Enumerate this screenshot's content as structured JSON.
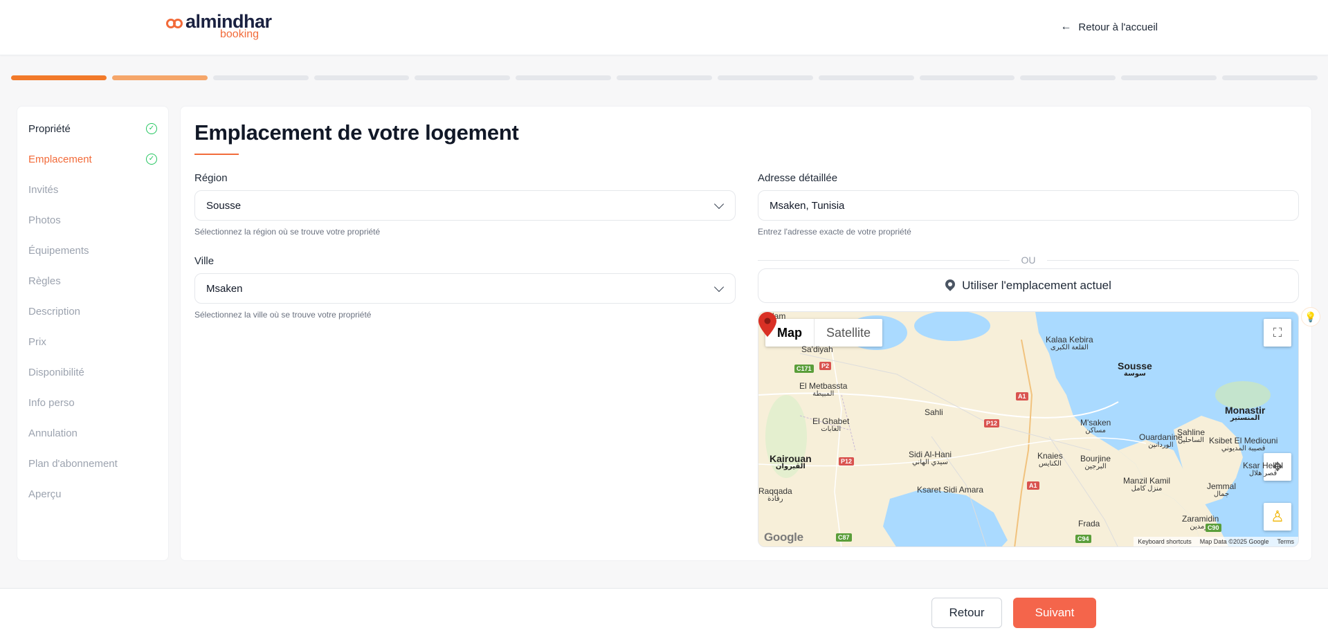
{
  "header": {
    "logo_main": "almindhar",
    "logo_sub": "booking",
    "back_home": "Retour à l'accueil"
  },
  "progress": {
    "total_steps": 13,
    "completed_steps": 1,
    "current_step": 2,
    "colors": {
      "done": "#f27a2a",
      "current": "#f5a66a",
      "todo": "#e5e7eb"
    }
  },
  "sidebar": {
    "items": [
      {
        "label": "Propriété",
        "state": "done"
      },
      {
        "label": "Emplacement",
        "state": "active"
      },
      {
        "label": "Invités",
        "state": "todo"
      },
      {
        "label": "Photos",
        "state": "todo"
      },
      {
        "label": "Équipements",
        "state": "todo"
      },
      {
        "label": "Règles",
        "state": "todo"
      },
      {
        "label": "Description",
        "state": "todo"
      },
      {
        "label": "Prix",
        "state": "todo"
      },
      {
        "label": "Disponibilité",
        "state": "todo"
      },
      {
        "label": "Info perso",
        "state": "todo"
      },
      {
        "label": "Annulation",
        "state": "todo"
      },
      {
        "label": "Plan d'abonnement",
        "state": "todo"
      },
      {
        "label": "Aperçu",
        "state": "todo"
      }
    ]
  },
  "main": {
    "title": "Emplacement de votre logement",
    "region": {
      "label": "Région",
      "value": "Sousse",
      "hint": "Sélectionnez la région où se trouve votre propriété"
    },
    "city": {
      "label": "Ville",
      "value": "Msaken",
      "hint": "Sélectionnez la ville où se trouve votre propriété"
    },
    "address": {
      "label": "Adresse détaillée",
      "value": "Msaken, Tunisia",
      "hint": "Entrez l'adresse exacte de votre propriété"
    },
    "or_text": "OU",
    "use_location": "Utiliser l'emplacement actuel"
  },
  "map": {
    "type_map": "Map",
    "type_satellite": "Satellite",
    "attribution_logo": "Google",
    "keyboard_shortcuts": "Keyboard shortcuts",
    "map_data": "Map Data ©2025 Google",
    "terms": "Terms",
    "places": [
      {
        "name": "Alam",
        "name_ar": ""
      },
      {
        "name": "Sa'diyah",
        "name_ar": ""
      },
      {
        "name": "Kalaa Kebira",
        "name_ar": "القلعة الكبرى"
      },
      {
        "name": "Sousse",
        "name_ar": "سوسة"
      },
      {
        "name": "El Metbassta",
        "name_ar": "المبيطة"
      },
      {
        "name": "Sahli",
        "name_ar": ""
      },
      {
        "name": "El Ghabet",
        "name_ar": "الغابات"
      },
      {
        "name": "Sahline",
        "name_ar": "الساحلين"
      },
      {
        "name": "Monastir",
        "name_ar": "المنستير"
      },
      {
        "name": "M'saken",
        "name_ar": "مساكن"
      },
      {
        "name": "Ouardanine",
        "name_ar": "الوردانين"
      },
      {
        "name": "Ksibet El Mediouni",
        "name_ar": "قصيبة المديوني"
      },
      {
        "name": "Kairouan",
        "name_ar": "القيروان"
      },
      {
        "name": "Sidi Al-Hani",
        "name_ar": "سيدي الهاني"
      },
      {
        "name": "Knaies",
        "name_ar": "الكنايس"
      },
      {
        "name": "Bourjine",
        "name_ar": "البرجين"
      },
      {
        "name": "Ksar Hellal",
        "name_ar": "قصر هلال"
      },
      {
        "name": "Raqqada",
        "name_ar": "رقادة"
      },
      {
        "name": "Ksaret Sidi Amara",
        "name_ar": ""
      },
      {
        "name": "Manzil Kamil",
        "name_ar": "منزل كامل"
      },
      {
        "name": "Jemmal",
        "name_ar": "جمال"
      },
      {
        "name": "Zaramidin",
        "name_ar": "زرمدين"
      },
      {
        "name": "Frada",
        "name_ar": ""
      }
    ],
    "roads": [
      "C171",
      "P2",
      "A1",
      "P12",
      "P12",
      "A1",
      "C87",
      "C94",
      "C90"
    ],
    "colors": {
      "land": "#f7efd9",
      "water": "#aadaff",
      "green": "#cfe8b8",
      "marker": "#d93025"
    }
  },
  "footer": {
    "back": "Retour",
    "next": "Suivant"
  },
  "colors": {
    "accent": "#f26b3a",
    "next_button": "#f4654b",
    "check": "#22c55e"
  }
}
